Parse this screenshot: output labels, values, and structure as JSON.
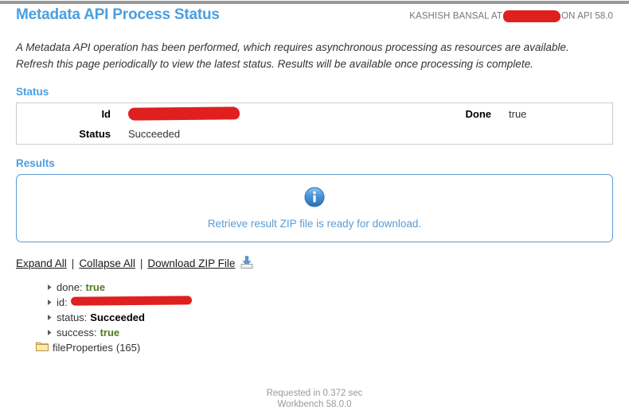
{
  "header": {
    "title": "Metadata API Process Status",
    "user_prefix": "KASHISH BANSAL AT",
    "user_suffix": "ON API 58.0"
  },
  "intro": "A Metadata API operation has been performed, which requires asynchronous processing as resources are available. Refresh this page periodically to view the latest status. Results will be available once processing is complete.",
  "status": {
    "heading": "Status",
    "id_label": "Id",
    "id_value": "",
    "done_label": "Done",
    "done_value": "true",
    "status_label": "Status",
    "status_value": "Succeeded"
  },
  "results": {
    "heading": "Results",
    "icon": "info-icon",
    "message": "Retrieve result ZIP file is ready for download."
  },
  "links": {
    "expand_all": "Expand All",
    "collapse_all": "Collapse All",
    "download_zip": "Download ZIP File",
    "separator": "|",
    "download_icon": "download-icon"
  },
  "tree": {
    "bullet_icon": "tree-node-arrow-icon",
    "folder_icon": "folder-icon",
    "rows": [
      {
        "key": "done:",
        "value": "true",
        "kind": "true"
      },
      {
        "key": "id:",
        "value": "",
        "kind": "link-redacted"
      },
      {
        "key": "status:",
        "value": "Succeeded",
        "kind": "bold"
      },
      {
        "key": "success:",
        "value": "true",
        "kind": "true"
      }
    ],
    "folder": {
      "label": "fileProperties",
      "count": "(165)"
    }
  },
  "footer": {
    "requested": "Requested in 0.372 sec",
    "version": "Workbench 58.0.0"
  },
  "colors": {
    "heading_blue": "#4a9fe0",
    "border_blue": "#5b9bd5",
    "redaction_red": "#e01f1f",
    "true_green": "#4e7d1e",
    "link_blue": "#1a4fa0",
    "top_bar_gray": "#999999"
  }
}
